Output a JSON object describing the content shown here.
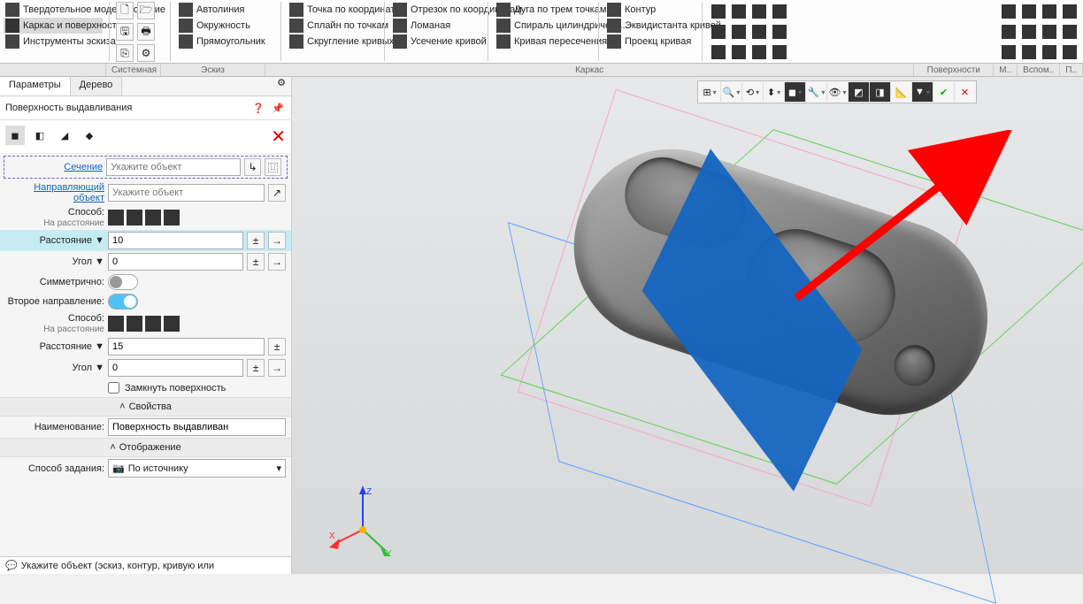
{
  "ribbon": {
    "left_nav": [
      {
        "label": "Твердотельное моделирование",
        "selected": false
      },
      {
        "label": "Каркас и поверхности",
        "selected": true
      },
      {
        "label": "Инструменты эскиза",
        "selected": false
      }
    ],
    "sketch_tools": [
      "Автолиния",
      "Окружность",
      "Прямоугольник"
    ],
    "point_tools": [
      "Точка по координатам",
      "Сплайн по точкам",
      "Скругление кривых"
    ],
    "segment_tools": [
      "Отрезок по координатам",
      "Ломаная",
      "Усечение кривой"
    ],
    "arc_tools": [
      "Дуга по трем точкам",
      "Спираль цилиндрическ...",
      "Кривая пересечения"
    ],
    "contour_tools": [
      "Контур",
      "Эквидистанта кривой",
      "Проекц кривая"
    ],
    "footer": [
      "Системная",
      "Эскиз",
      "Каркас",
      "",
      "Поверхности",
      "М..",
      "Вспом..",
      "П.."
    ]
  },
  "panel": {
    "tabs": {
      "t1": "Параметры",
      "t2": "Дерево"
    },
    "title": "Поверхность выдавливания",
    "rows": {
      "section_link": "Сечение",
      "section_placeholder": "Укажите объект",
      "guide_link": "Направляющий объект",
      "guide_placeholder": "Укажите объект",
      "method": "Способ:",
      "by_distance": "На расстояние",
      "distance": "Расстояние",
      "distance_val": "10",
      "angle": "Угол",
      "angle_val": "0",
      "symm": "Симметрично:",
      "dir2": "Второе направление:",
      "distance2_val": "15",
      "angle2_val": "0",
      "close_surf": "Замкнуть поверхность"
    },
    "sections": {
      "props": "Свойства",
      "display": "Отображение"
    },
    "name_label": "Наименование:",
    "name_val": "Поверхность выдавливан",
    "disp_mode_label": "Способ задания:",
    "disp_mode_val": "По источнику",
    "status": "Укажите объект (эскиз, контур, кривую или"
  },
  "axes": {
    "x": "X",
    "y": "Y",
    "z": "Z"
  }
}
